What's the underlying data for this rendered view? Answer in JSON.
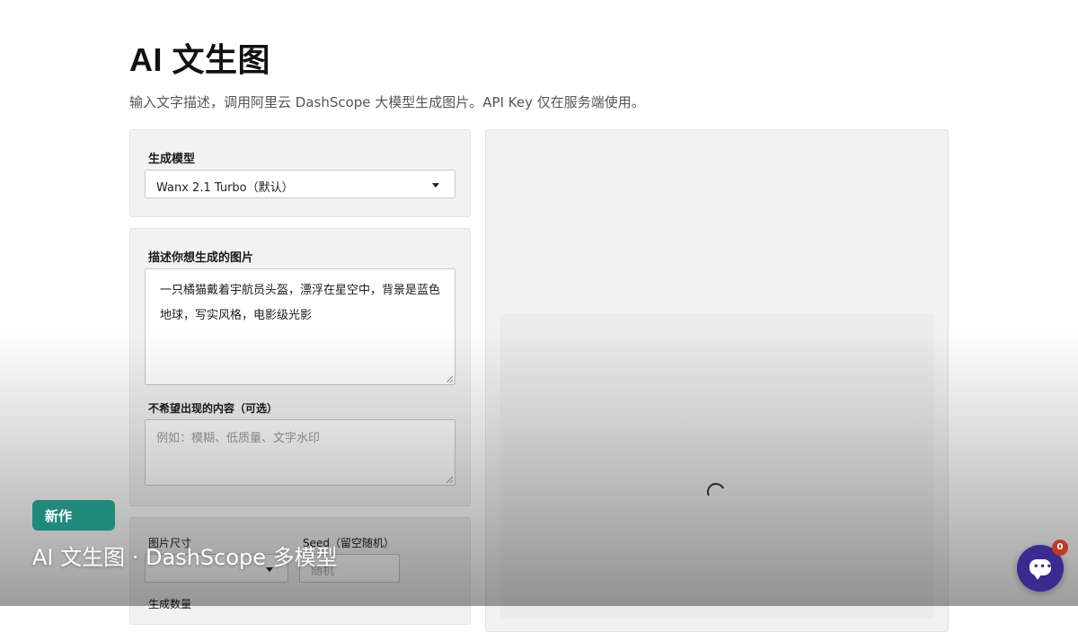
{
  "header": {
    "title": "AI 文生图",
    "subtitle": "输入文字描述，调用阿里云 DashScope 大模型生成图片。API Key 仅在服务端使用。"
  },
  "form": {
    "model_label": "生成模型",
    "model_value": "Wanx 2.1 Turbo（默认）",
    "prompt_label": "描述你想生成的图片",
    "prompt_value": "一只橘猫戴着宇航员头盔，漂浮在星空中，背景是蓝色地球，写实风格，电影级光影",
    "negative_label": "不希望出现的内容（可选）",
    "negative_placeholder": "例如：模糊、低质量、文字水印",
    "size_label": "图片尺寸",
    "seed_label": "Seed（留空随机）",
    "seed_placeholder": "随机",
    "count_label": "生成数量"
  },
  "overlay": {
    "badge": "新作",
    "title": "AI 文生图 · DashScope 多模型"
  },
  "chat": {
    "unread_count": "0",
    "dots": "•••"
  },
  "colors": {
    "badge_bg": "#1f8a7a",
    "chat_bg": "#3b2a8f",
    "count_bg": "#c0392b"
  }
}
